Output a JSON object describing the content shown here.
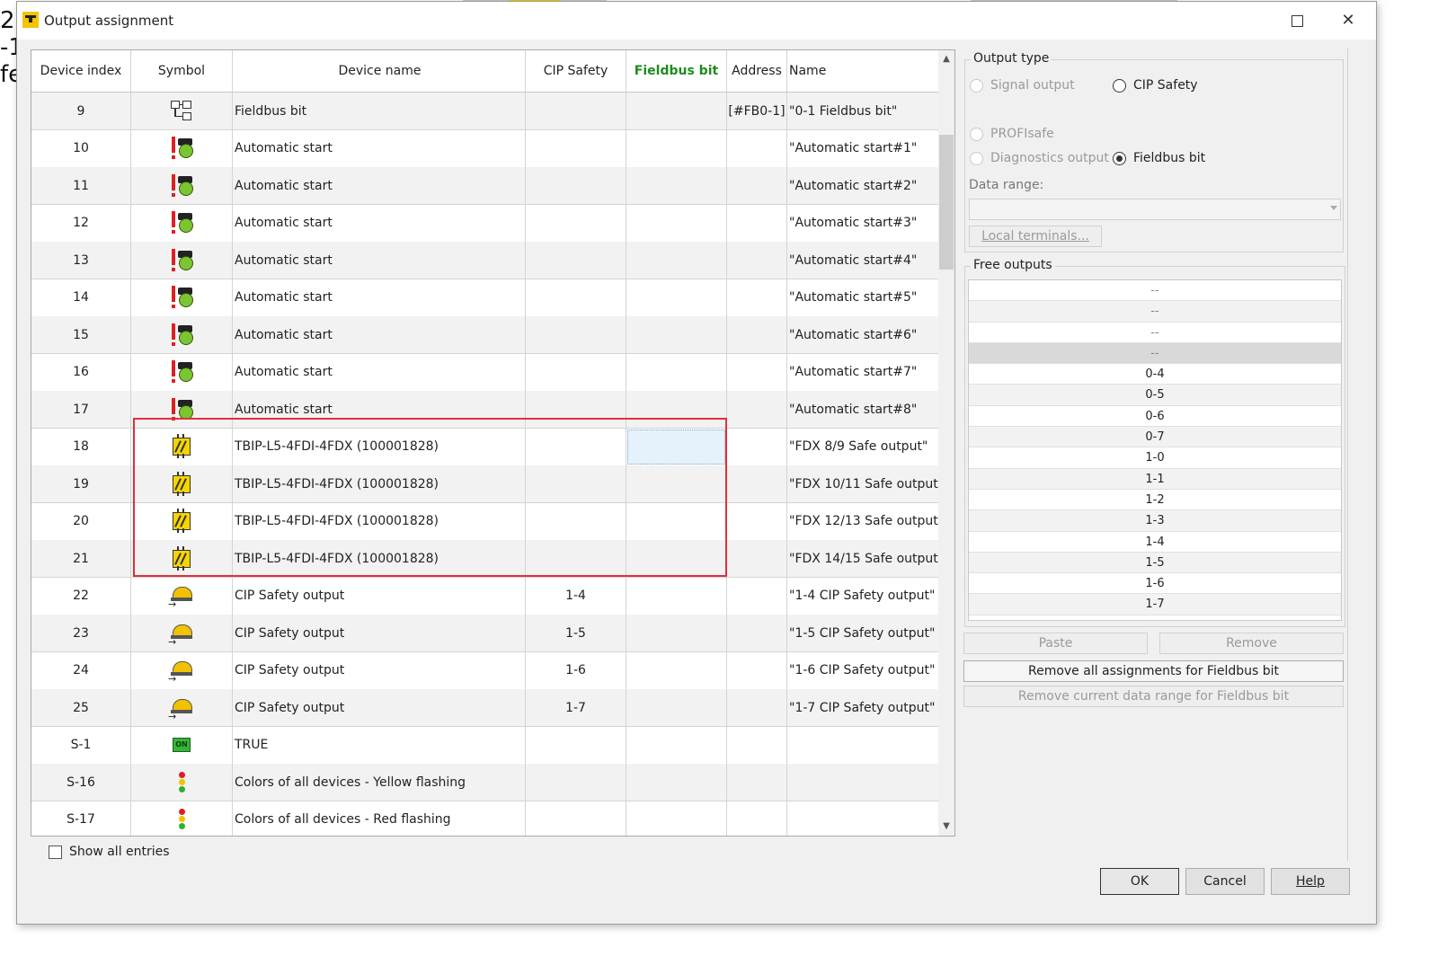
{
  "background": {
    "fragments": [
      "2]",
      "-1",
      "fe"
    ]
  },
  "window": {
    "title": "Output assignment",
    "maximize_icon": "maximize-icon",
    "close_glyph": "✕"
  },
  "grid": {
    "columns": [
      "Device index",
      "Symbol",
      "Device name",
      "CIP Safety",
      "Fieldbus bit",
      "Address",
      "Name"
    ],
    "rows": [
      {
        "index": "9",
        "icon": "fieldbus-icon",
        "device": "Fieldbus bit",
        "cip": "",
        "fb": "",
        "address": "[#FB0-1]",
        "name": "\"0-1 Fieldbus bit\""
      },
      {
        "index": "10",
        "icon": "automatic-start-icon",
        "device": "Automatic start",
        "cip": "",
        "fb": "",
        "address": "",
        "name": "\"Automatic start#1\""
      },
      {
        "index": "11",
        "icon": "automatic-start-icon",
        "device": "Automatic start",
        "cip": "",
        "fb": "",
        "address": "",
        "name": "\"Automatic start#2\""
      },
      {
        "index": "12",
        "icon": "automatic-start-icon",
        "device": "Automatic start",
        "cip": "",
        "fb": "",
        "address": "",
        "name": "\"Automatic start#3\""
      },
      {
        "index": "13",
        "icon": "automatic-start-icon",
        "device": "Automatic start",
        "cip": "",
        "fb": "",
        "address": "",
        "name": "\"Automatic start#4\""
      },
      {
        "index": "14",
        "icon": "automatic-start-icon",
        "device": "Automatic start",
        "cip": "",
        "fb": "",
        "address": "",
        "name": "\"Automatic start#5\""
      },
      {
        "index": "15",
        "icon": "automatic-start-icon",
        "device": "Automatic start",
        "cip": "",
        "fb": "",
        "address": "",
        "name": "\"Automatic start#6\""
      },
      {
        "index": "16",
        "icon": "automatic-start-icon",
        "device": "Automatic start",
        "cip": "",
        "fb": "",
        "address": "",
        "name": "\"Automatic start#7\""
      },
      {
        "index": "17",
        "icon": "automatic-start-icon",
        "device": "Automatic start",
        "cip": "",
        "fb": "",
        "address": "",
        "name": "\"Automatic start#8\""
      },
      {
        "index": "18",
        "icon": "fdx-output-icon",
        "device": "TBIP-L5-4FDI-4FDX (100001828)",
        "cip": "",
        "fb": "",
        "address": "",
        "name": "\"FDX 8/9 Safe output\"",
        "selected_fb": true
      },
      {
        "index": "19",
        "icon": "fdx-output-icon",
        "device": "TBIP-L5-4FDI-4FDX (100001828)",
        "cip": "",
        "fb": "",
        "address": "",
        "name": "\"FDX 10/11 Safe output\""
      },
      {
        "index": "20",
        "icon": "fdx-output-icon",
        "device": "TBIP-L5-4FDI-4FDX (100001828)",
        "cip": "",
        "fb": "",
        "address": "",
        "name": "\"FDX 12/13 Safe output\""
      },
      {
        "index": "21",
        "icon": "fdx-output-icon",
        "device": "TBIP-L5-4FDI-4FDX (100001828)",
        "cip": "",
        "fb": "",
        "address": "",
        "name": "\"FDX 14/15 Safe output\""
      },
      {
        "index": "22",
        "icon": "cip-safety-output-icon",
        "device": "CIP Safety output",
        "cip": "1-4",
        "fb": "",
        "address": "",
        "name": "\"1-4 CIP Safety output\""
      },
      {
        "index": "23",
        "icon": "cip-safety-output-icon",
        "device": "CIP Safety output",
        "cip": "1-5",
        "fb": "",
        "address": "",
        "name": "\"1-5 CIP Safety output\""
      },
      {
        "index": "24",
        "icon": "cip-safety-output-icon",
        "device": "CIP Safety output",
        "cip": "1-6",
        "fb": "",
        "address": "",
        "name": "\"1-6 CIP Safety output\""
      },
      {
        "index": "25",
        "icon": "cip-safety-output-icon",
        "device": "CIP Safety output",
        "cip": "1-7",
        "fb": "",
        "address": "",
        "name": "\"1-7 CIP Safety output\""
      },
      {
        "index": "S-1",
        "icon": "on-icon",
        "icon_text": "ON",
        "device": "TRUE",
        "cip": "",
        "fb": "",
        "address": "",
        "name": ""
      },
      {
        "index": "S-16",
        "icon": "traffic-light-icon",
        "device": "Colors of all devices - Yellow flashing",
        "cip": "",
        "fb": "",
        "address": "",
        "name": ""
      },
      {
        "index": "S-17",
        "icon": "traffic-light-icon",
        "device": "Colors of all devices - Red flashing",
        "cip": "",
        "fb": "",
        "address": "",
        "name": ""
      }
    ]
  },
  "show_all_entries": {
    "label": "Show all entries",
    "checked": false
  },
  "output_type": {
    "label": "Output type",
    "options": {
      "signal_output": "Signal output",
      "cip_safety": "CIP Safety",
      "profisafe": "PROFIsafe",
      "diagnostics_output": "Diagnostics output",
      "fieldbus_bit": "Fieldbus bit"
    },
    "selected": "Fieldbus bit",
    "data_range_label": "Data range:",
    "data_range_value": "",
    "local_terminals": "Local terminals..."
  },
  "free_outputs": {
    "label": "Free outputs",
    "items": [
      "--",
      "--",
      "--",
      "--",
      "0-4",
      "0-5",
      "0-6",
      "0-7",
      "1-0",
      "1-1",
      "1-2",
      "1-3",
      "1-4",
      "1-5",
      "1-6",
      "1-7"
    ],
    "selected_index": 3
  },
  "buttons": {
    "paste": "Paste",
    "remove": "Remove",
    "remove_all": "Remove all assignments for Fieldbus bit",
    "remove_current": "Remove current data range for Fieldbus bit",
    "ok": "OK",
    "cancel": "Cancel",
    "help": "Help"
  },
  "colors": {
    "highlight_box": "#e0303a",
    "fieldbus_header": "#1f8a1f",
    "brand": "#f5c400"
  }
}
